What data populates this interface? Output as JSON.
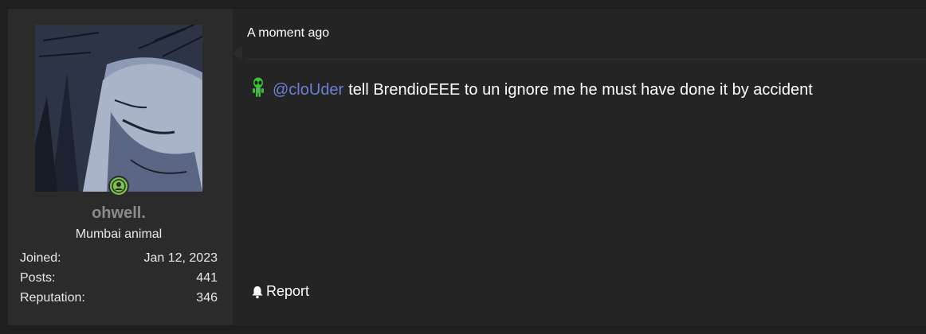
{
  "post": {
    "timestamp": "A moment ago",
    "mention": "@cloUder",
    "message_text": "tell BrendioEEE to un ignore me he must have done it by accident",
    "report_label": "Report",
    "emoji_icon": "alien-icon",
    "report_icon": "bell-icon"
  },
  "user": {
    "username": "ohwell.",
    "title": "Mumbai animal",
    "status": "online",
    "stats": [
      {
        "label": "Joined:",
        "value": "Jan 12, 2023"
      },
      {
        "label": "Posts:",
        "value": "441"
      },
      {
        "label": "Reputation:",
        "value": "346"
      }
    ]
  },
  "colors": {
    "background": "#1f1f1f",
    "panel": "#2b2b2b",
    "mention": "#6b7fd6",
    "online": "#7cc24a",
    "username": "#8b8b8b"
  }
}
